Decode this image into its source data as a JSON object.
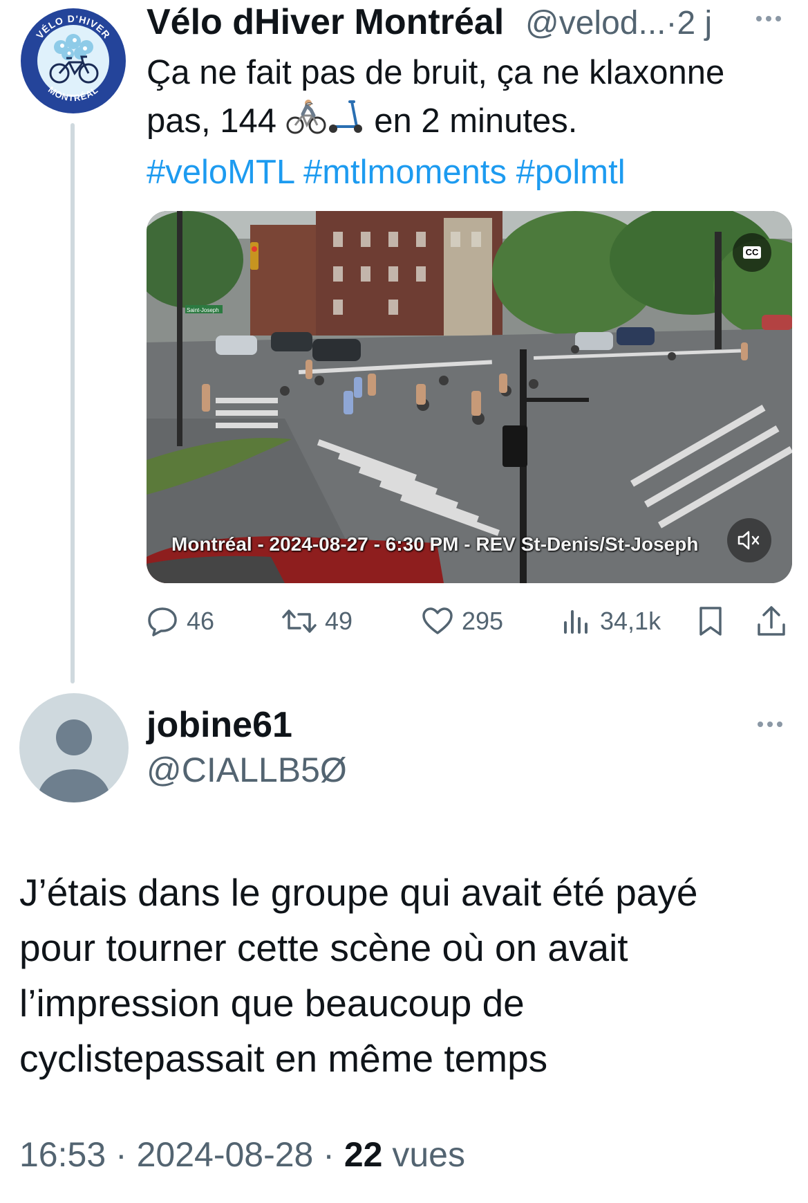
{
  "tweet": {
    "author_name": "Vélo dHiver Montréal",
    "author_handle": "@velod...",
    "time_sep": "·",
    "time_ago": "2 j",
    "text_line1": "Ça ne fait pas de bruit, ça ne klaxonne",
    "text_line2_before": "pas, 144 ",
    "emoji_1": "cyclist-emoji",
    "emoji_2": "scooter-emoji",
    "text_line2_after": " en 2 minutes.",
    "hashtags": [
      "#veloMTL",
      "#mtlmoments",
      "#polmtl"
    ],
    "avatar_logo": {
      "top_text": "VÉLO D'HIVER",
      "bottom_text": "MONTRÉAL",
      "colors": {
        "ring": "#24449a",
        "inner": "#dff1fb",
        "snow": "#8ecbe8"
      }
    },
    "video": {
      "overlay_caption": "Montréal - 2024-08-27 - 6:30 PM - REV St-Denis/St-Joseph",
      "cc_label": "CC",
      "street_sign": "Saint-Joseph"
    },
    "stats": {
      "replies": "46",
      "retweets": "49",
      "likes": "295",
      "views": "34,1k"
    }
  },
  "reply": {
    "name": "jobine61",
    "handle": "@CIALLB5Ø",
    "text_lines": [
      "J’étais dans le groupe qui avait été payé",
      "pour tourner cette scène où on avait",
      "l’impression que beaucoup de",
      "cyclistepassait en même temps"
    ],
    "time": "16:53",
    "date": "2024-08-28",
    "views_count": "22",
    "views_label": "vues",
    "sep": "·"
  },
  "colors": {
    "link": "#1d9bf0",
    "secondary": "#536471",
    "primary": "#0f1419"
  }
}
